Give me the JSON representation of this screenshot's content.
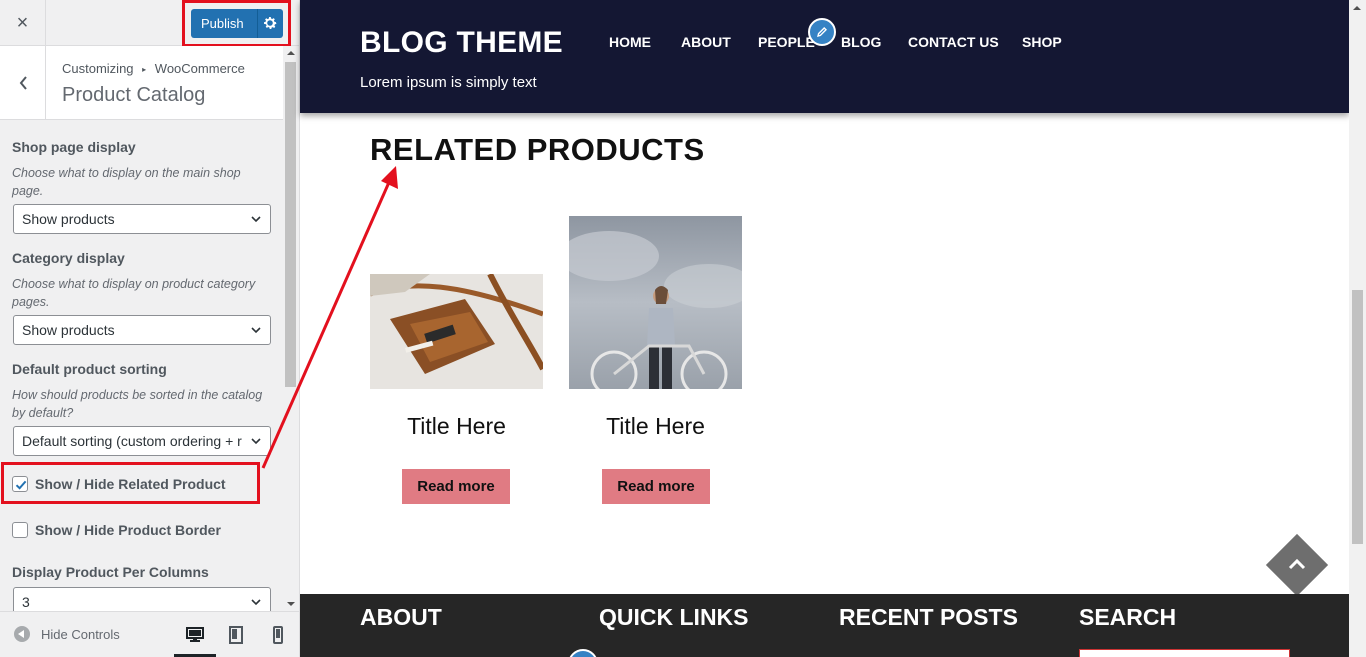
{
  "customizer": {
    "close_label": "×",
    "publish_label": "Publish",
    "breadcrumb": {
      "root": "Customizing",
      "arrow": "▸",
      "parent": "WooCommerce"
    },
    "section_title": "Product Catalog",
    "controls": {
      "shop_display": {
        "title": "Shop page display",
        "description": "Choose what to display on the main shop page.",
        "value": "Show products"
      },
      "category_display": {
        "title": "Category display",
        "description": "Choose what to display on product category pages.",
        "value": "Show products"
      },
      "sorting": {
        "title": "Default product sorting",
        "description": "How should products be sorted in the catalog by default?",
        "value": "Default sorting (custom ordering + r"
      },
      "related": {
        "label": "Show / Hide Related Product",
        "checked": true
      },
      "border": {
        "label": "Show / Hide Product Border",
        "checked": false
      },
      "columns": {
        "title": "Display Product Per Columns",
        "value": "3"
      }
    },
    "footer": {
      "hide_controls_label": "Hide Controls",
      "devices": [
        "desktop-icon",
        "tablet-icon",
        "mobile-icon"
      ],
      "active_device": "desktop"
    }
  },
  "preview": {
    "site_title": "BLOG THEME",
    "tagline": "Lorem ipsum is simply text",
    "nav": [
      "HOME",
      "ABOUT",
      "PEOPLE",
      "BLOG",
      "CONTACT US",
      "SHOP"
    ],
    "related_heading": "RELATED PRODUCTS",
    "products": [
      {
        "title": "Title Here",
        "button": "Read more",
        "image": "leather-bag-photo"
      },
      {
        "title": "Title Here",
        "button": "Read more",
        "image": "man-with-bicycle-photo"
      }
    ],
    "footer_headings": [
      "ABOUT",
      "QUICK LINKS",
      "RECENT POSTS",
      "SEARCH"
    ]
  },
  "colors": {
    "accent": "#2271b1",
    "header_bg": "#141733",
    "button_bg": "#e07b83",
    "footer_bg": "#262626",
    "highlight": "#e3101e"
  }
}
